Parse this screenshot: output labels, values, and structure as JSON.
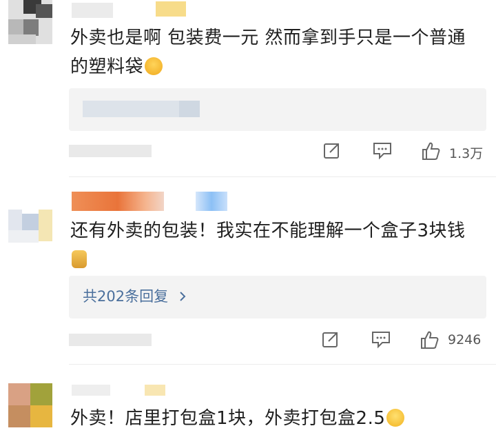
{
  "comments": [
    {
      "text": "外卖也是啊 包装费一元 然而拿到手只是一个普通的塑料袋",
      "emoji": "smirk-face-emoji",
      "like_count": "1.3万"
    },
    {
      "text": "还有外卖的包装！我实在不能理解一个盒子3块钱",
      "emoji": "thumbs-up-emoji",
      "reply_label": "共202条回复",
      "like_count": "9246"
    },
    {
      "text": "外卖！店里打包盒1块，外卖打包盒2.5",
      "emoji": "grinning-face-emoji"
    }
  ],
  "colors": {
    "link": "#4a6f9c",
    "emoji": "#f5c542",
    "reply_bg": "#f3f3f3"
  }
}
